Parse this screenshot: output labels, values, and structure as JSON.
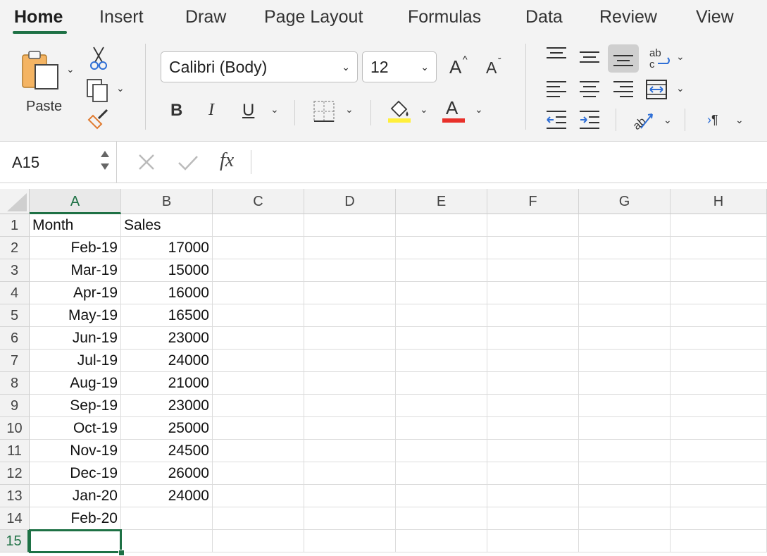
{
  "ribbon": {
    "tabs": [
      "Home",
      "Insert",
      "Draw",
      "Page Layout",
      "Formulas",
      "Data",
      "Review",
      "View"
    ],
    "active_tab": "Home",
    "paste_label": "Paste",
    "font_name": "Calibri (Body)",
    "font_size": "12",
    "bold_label": "B",
    "italic_label": "I",
    "underline_label": "U",
    "increase_font_label": "A",
    "decrease_font_label": "A",
    "font_color_label": "A",
    "highlight_color": "#ffef3a",
    "font_color": "#e8302a"
  },
  "formula_bar": {
    "name_box": "A15",
    "fx_label": "fx",
    "value": ""
  },
  "sheet": {
    "columns": [
      "A",
      "B",
      "C",
      "D",
      "E",
      "F",
      "G",
      "H"
    ],
    "rows": [
      "1",
      "2",
      "3",
      "4",
      "5",
      "6",
      "7",
      "8",
      "9",
      "10",
      "11",
      "12",
      "13",
      "14",
      "15"
    ],
    "cells": [
      [
        "Month",
        "Sales"
      ],
      [
        "Feb-19",
        "17000"
      ],
      [
        "Mar-19",
        "15000"
      ],
      [
        "Apr-19",
        "16000"
      ],
      [
        "May-19",
        "16500"
      ],
      [
        "Jun-19",
        "23000"
      ],
      [
        "Jul-19",
        "24000"
      ],
      [
        "Aug-19",
        "21000"
      ],
      [
        "Sep-19",
        "23000"
      ],
      [
        "Oct-19",
        "25000"
      ],
      [
        "Nov-19",
        "24500"
      ],
      [
        "Dec-19",
        "26000"
      ],
      [
        "Jan-20",
        "24000"
      ],
      [
        "Feb-20",
        ""
      ],
      [
        "",
        ""
      ]
    ],
    "selected_cell": "A15",
    "accent_color": "#1e7145"
  }
}
